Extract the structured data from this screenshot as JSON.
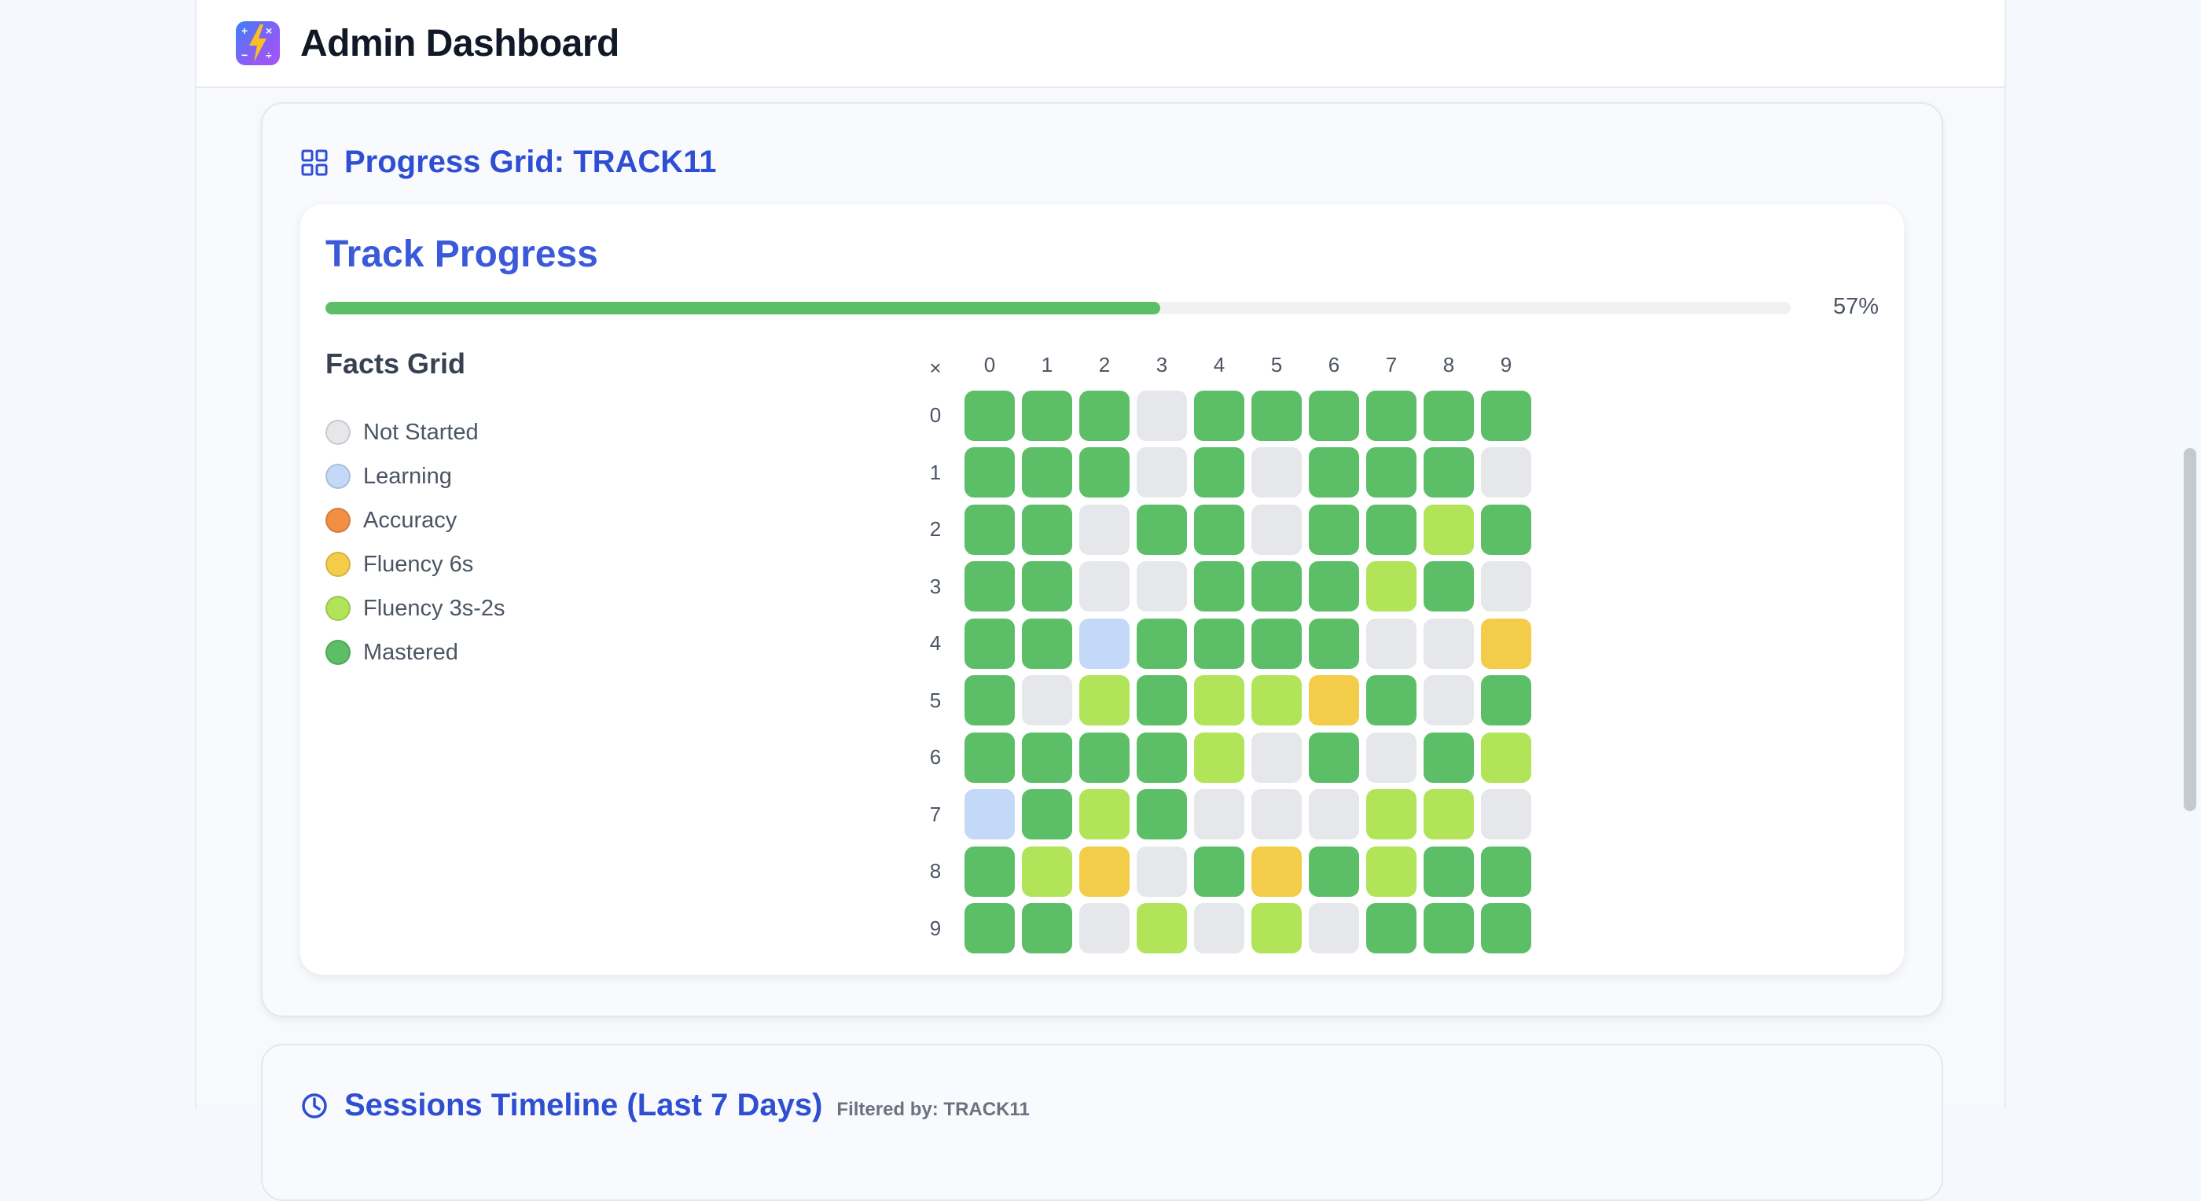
{
  "header": {
    "title": "Admin Dashboard",
    "logo_icon": "math-bolt-logo"
  },
  "progress_section": {
    "title": "Progress Grid: TRACK11",
    "icon": "grid-icon",
    "card_title": "Track Progress",
    "progress_value": 0.57,
    "progress_label": "57%",
    "facts_title": "Facts Grid",
    "legend": [
      {
        "key": "n",
        "label": "Not Started",
        "color": "#e5e7eb"
      },
      {
        "key": "l",
        "label": "Learning",
        "color": "#c4d9f8"
      },
      {
        "key": "a",
        "label": "Accuracy",
        "color": "#f28f45"
      },
      {
        "key": "y",
        "label": "Fluency 6s",
        "color": "#f3cd4a"
      },
      {
        "key": "f",
        "label": "Fluency 3s-2s",
        "color": "#b2e45a"
      },
      {
        "key": "m",
        "label": "Mastered",
        "color": "#5cbf68"
      }
    ],
    "grid": {
      "corner": "×",
      "columns": [
        "0",
        "1",
        "2",
        "3",
        "4",
        "5",
        "6",
        "7",
        "8",
        "9"
      ],
      "rows": [
        "0",
        "1",
        "2",
        "3",
        "4",
        "5",
        "6",
        "7",
        "8",
        "9"
      ],
      "cells": [
        [
          "m",
          "m",
          "m",
          "n",
          "m",
          "m",
          "m",
          "m",
          "m",
          "m"
        ],
        [
          "m",
          "m",
          "m",
          "n",
          "m",
          "n",
          "m",
          "m",
          "m",
          "n"
        ],
        [
          "m",
          "m",
          "n",
          "m",
          "m",
          "n",
          "m",
          "m",
          "f",
          "m"
        ],
        [
          "m",
          "m",
          "n",
          "n",
          "m",
          "m",
          "m",
          "f",
          "m",
          "n"
        ],
        [
          "m",
          "m",
          "l",
          "m",
          "m",
          "m",
          "m",
          "n",
          "n",
          "y"
        ],
        [
          "m",
          "n",
          "f",
          "m",
          "f",
          "f",
          "y",
          "m",
          "n",
          "m"
        ],
        [
          "m",
          "m",
          "m",
          "m",
          "f",
          "n",
          "m",
          "n",
          "m",
          "f"
        ],
        [
          "l",
          "m",
          "f",
          "m",
          "n",
          "n",
          "n",
          "f",
          "f",
          "n"
        ],
        [
          "m",
          "f",
          "y",
          "n",
          "m",
          "y",
          "m",
          "f",
          "m",
          "m"
        ],
        [
          "m",
          "m",
          "n",
          "f",
          "n",
          "f",
          "n",
          "m",
          "m",
          "m"
        ]
      ]
    }
  },
  "sessions_section": {
    "title": "Sessions Timeline (Last 7 Days)",
    "filter_label": "Filtered by: TRACK11",
    "icon": "clock-icon"
  }
}
